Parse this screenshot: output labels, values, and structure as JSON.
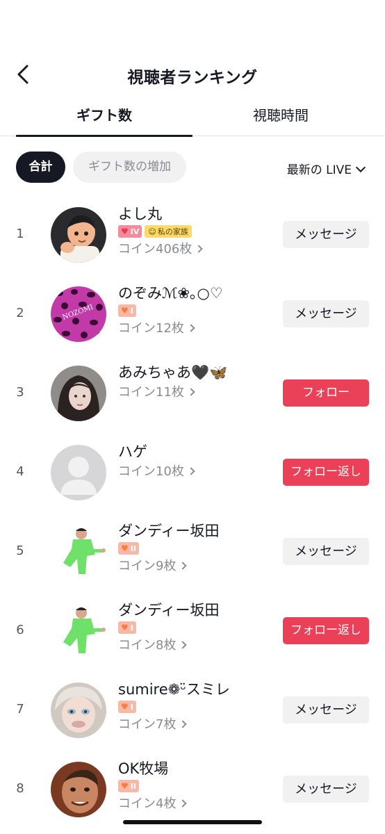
{
  "header": {
    "title": "視聴者ランキング"
  },
  "tabs": [
    {
      "label": "ギフト数"
    },
    {
      "label": "視聴時間"
    }
  ],
  "filters": {
    "total": "合計",
    "increase": "ギフト数の増加",
    "period": "最新の LIVE"
  },
  "viewers": [
    {
      "rank": "1",
      "name": "よし丸",
      "badge_level": "IV",
      "family_badge": "私の家族",
      "coins": "コイン406枚",
      "button": "メッセージ"
    },
    {
      "rank": "2",
      "name": "のぞみℳ❀｡○♡",
      "badge_level": "I",
      "coins": "コイン12枚",
      "button": "メッセージ"
    },
    {
      "rank": "3",
      "name": "あみちゃあ🖤🦋",
      "coins": "コイン11枚",
      "button": "フォロー"
    },
    {
      "rank": "4",
      "name": "ハゲ",
      "coins": "コイン10枚",
      "button": "フォロー返し"
    },
    {
      "rank": "5",
      "name": "ダンディー坂田",
      "badge_level": "II",
      "coins": "コイン9枚",
      "button": "メッセージ"
    },
    {
      "rank": "6",
      "name": "ダンディー坂田",
      "badge_level": "I",
      "coins": "コイン8枚",
      "button": "フォロー返し"
    },
    {
      "rank": "7",
      "name": "sumire❁ᵕ̈スミレ",
      "badge_level": "I",
      "coins": "コイン7枚",
      "button": "メッセージ"
    },
    {
      "rank": "8",
      "name": "OK牧場",
      "badge_level": "II",
      "coins": "コイン4枚",
      "button": "メッセージ"
    }
  ],
  "colors": {
    "accent_red": "#ea4158",
    "text_primary": "#161823",
    "text_secondary": "#8a8b91"
  }
}
